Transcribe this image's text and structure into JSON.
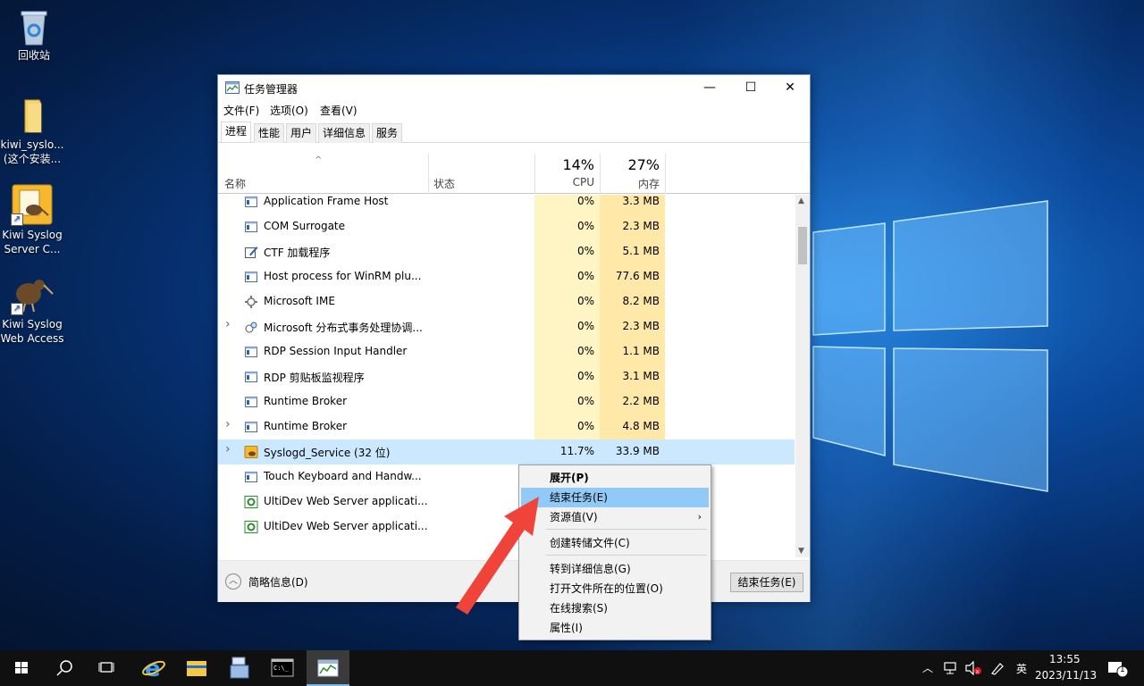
{
  "desktop": {
    "icons": [
      {
        "label": "回收站",
        "icon": "recycle-bin-icon"
      },
      {
        "label": "kiwi_syslo...\n(这个安装...",
        "line1": "kiwi_syslo...",
        "line2": "(这个安装...",
        "icon": "folder-icon"
      },
      {
        "line1": "Kiwi Syslog",
        "line2": "Server C...",
        "icon": "kiwi-syslog-server-icon"
      },
      {
        "line1": "Kiwi Syslog",
        "line2": "Web Access",
        "icon": "kiwi-bird-icon"
      }
    ]
  },
  "window": {
    "title": "任务管理器",
    "minimize": "—",
    "maximize": "☐",
    "close": "✕"
  },
  "menu": {
    "file": "文件(F)",
    "options": "选项(O)",
    "view": "查看(V)"
  },
  "tabs": [
    {
      "label": "进程",
      "active": true
    },
    {
      "label": "性能"
    },
    {
      "label": "用户"
    },
    {
      "label": "详细信息"
    },
    {
      "label": "服务"
    }
  ],
  "columns": {
    "sort_arrow": "^",
    "name": "名称",
    "status": "状态",
    "cpu_pct": "14%",
    "cpu_label": "CPU",
    "mem_pct": "27%",
    "mem_label": "内存"
  },
  "processes": [
    {
      "name": "Application Frame Host",
      "cpu": "0%",
      "mem": "3.3 MB",
      "expandable": false,
      "icon": "window-app-icon"
    },
    {
      "name": "COM Surrogate",
      "cpu": "0%",
      "mem": "2.3 MB",
      "expandable": false,
      "icon": "window-app-icon"
    },
    {
      "name": "CTF 加载程序",
      "cpu": "0%",
      "mem": "5.1 MB",
      "expandable": false,
      "icon": "pen-notepad-icon"
    },
    {
      "name": "Host process for WinRM plu...",
      "cpu": "0%",
      "mem": "77.6 MB",
      "expandable": false,
      "icon": "window-app-icon"
    },
    {
      "name": "Microsoft IME",
      "cpu": "0%",
      "mem": "8.2 MB",
      "expandable": false,
      "icon": "ime-gear-icon"
    },
    {
      "name": "Microsoft 分布式事务处理协调...",
      "cpu": "0%",
      "mem": "2.3 MB",
      "expandable": true,
      "icon": "globe-network-icon"
    },
    {
      "name": "RDP Session Input Handler",
      "cpu": "0%",
      "mem": "1.1 MB",
      "expandable": false,
      "icon": "window-app-icon"
    },
    {
      "name": "RDP 剪贴板监视程序",
      "cpu": "0%",
      "mem": "3.1 MB",
      "expandable": false,
      "icon": "window-app-icon"
    },
    {
      "name": "Runtime Broker",
      "cpu": "0%",
      "mem": "2.2 MB",
      "expandable": false,
      "icon": "window-app-icon"
    },
    {
      "name": "Runtime Broker",
      "cpu": "0%",
      "mem": "4.8 MB",
      "expandable": true,
      "icon": "window-app-icon"
    },
    {
      "name": "Syslogd_Service (32 位)",
      "cpu": "11.7%",
      "mem": "33.9 MB",
      "expandable": true,
      "selected": true,
      "icon": "kiwi-service-icon"
    },
    {
      "name": "Touch Keyboard and Handw...",
      "cpu": "",
      "mem": "",
      "expandable": false,
      "icon": "window-app-icon"
    },
    {
      "name": "UltiDev Web Server applicati...",
      "cpu": "",
      "mem": "",
      "expandable": false,
      "icon": "green-gear-icon"
    },
    {
      "name": "UltiDev Web Server applicati...",
      "cpu": "",
      "mem": "",
      "expandable": false,
      "icon": "green-gear-icon"
    }
  ],
  "footer": {
    "fewer_details": "简略信息(D)",
    "end_task": "结束任务(E)"
  },
  "context_menu": {
    "expand": "展开(P)",
    "end_task": "结束任务(E)",
    "resource_values": "资源值(V)",
    "create_dump": "创建转储文件(C)",
    "go_to_details": "转到详细信息(G)",
    "open_file_location": "打开文件所在的位置(O)",
    "search_online": "在线搜索(S)",
    "properties": "属性(I)"
  },
  "taskbar": {
    "ime_label": "英",
    "time": "13:55",
    "date": "2023/11/13",
    "notification_count": "1",
    "apps": [
      "start-icon",
      "search-icon",
      "task-view-icon",
      "internet-explorer-icon",
      "file-explorer-icon",
      "server-manager-icon",
      "cmd-icon",
      "task-manager-icon"
    ]
  },
  "colors": {
    "selected_row": "#cce8ff",
    "cpu_column": "#fff4c4",
    "mem_column": "#ffe8a8",
    "menu_highlight": "#91c9f7",
    "annotation_arrow": "#f0433a"
  }
}
